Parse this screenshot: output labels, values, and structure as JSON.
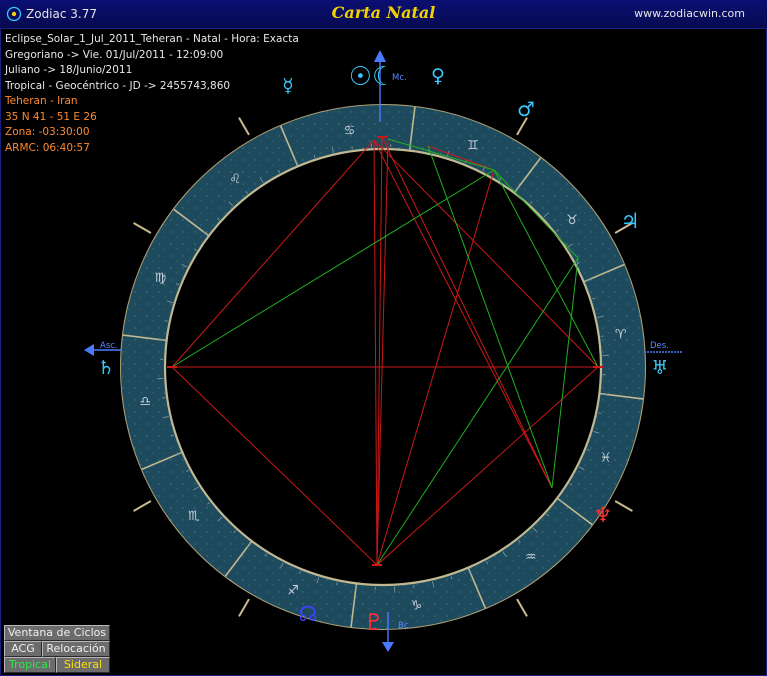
{
  "window": {
    "app_name": "Zodiac 3.77",
    "title": "Carta Natal",
    "site": "www.zodiacwin.com"
  },
  "info": {
    "white_lines": [
      "Eclipse_Solar_1_Jul_2011_Teheran - Natal - Hora: Exacta",
      "Gregoriano -> Vie. 01/Jul/2011 - 12:09:00",
      "Juliano -> 18/Junio/2011",
      "Tropical - Geocéntrico - JD -> 2455743,860"
    ],
    "orange_lines": [
      "Teheran - Iran",
      "35 N 41 - 51 E 26",
      "Zona: -03:30:00",
      "ARMC: 06:40:57"
    ]
  },
  "angles": {
    "mc": "Mc.",
    "asc": "Asc.",
    "des": "Des.",
    "ic": "Bc."
  },
  "signs": [
    "♈",
    "♉",
    "♊",
    "♋",
    "♌",
    "♍",
    "♎",
    "♏",
    "♐",
    "♑",
    "♒",
    "♓"
  ],
  "planets": [
    {
      "glyph": "☉☾",
      "name": "sun-moon",
      "color": "#38c8ff"
    },
    {
      "glyph": "♀",
      "name": "venus",
      "color": "#38c8ff"
    },
    {
      "glyph": "♂",
      "name": "mars",
      "color": "#38c8ff"
    },
    {
      "glyph": "♃",
      "name": "jupiter",
      "color": "#38c8ff"
    },
    {
      "glyph": "♅",
      "name": "uranus",
      "color": "#38c8ff"
    },
    {
      "glyph": "♆",
      "name": "neptune",
      "color": "#ff3030"
    },
    {
      "glyph": "♇",
      "name": "pluto",
      "color": "#ff3030"
    },
    {
      "glyph": "☊",
      "name": "node",
      "color": "#4040ff"
    },
    {
      "glyph": "♄",
      "name": "saturn",
      "color": "#38c8ff"
    },
    {
      "glyph": "☿",
      "name": "mercury",
      "color": "#38c8ff"
    }
  ],
  "buttons": {
    "ciclos": "Ventana de Ciclos",
    "acg": "ACG",
    "reloc": "Relocación",
    "tropical": "Tropical",
    "sideral": "Sideral"
  }
}
